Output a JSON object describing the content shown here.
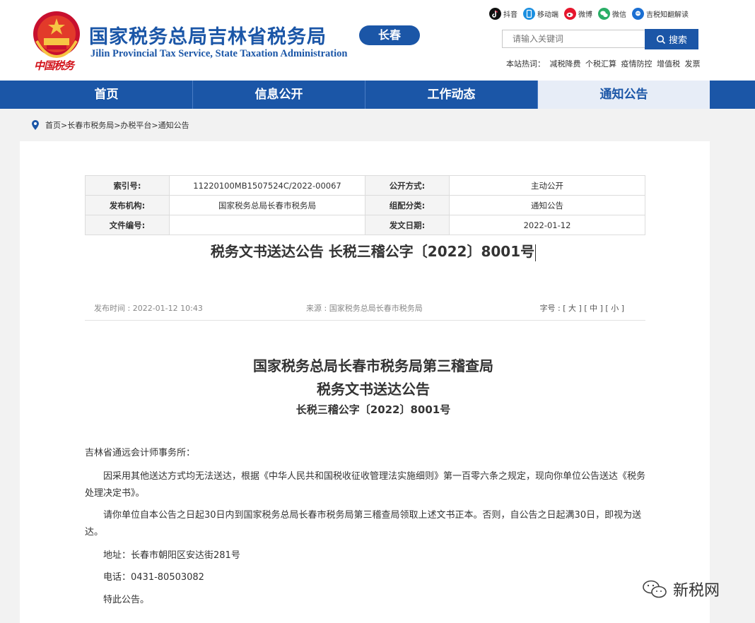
{
  "header": {
    "seal_text": "中国税务",
    "title_cn": "国家税务总局吉林省税务局",
    "title_en": "Jilin Provincial Tax Service, State Taxation Administration",
    "city": "长春",
    "social": [
      {
        "label": "抖音",
        "icon": "douyin-icon",
        "color": "#111111"
      },
      {
        "label": "移动端",
        "icon": "mobile-icon",
        "color": "#1b8fe0"
      },
      {
        "label": "微博",
        "icon": "weibo-icon",
        "color": "#e6162d"
      },
      {
        "label": "微信",
        "icon": "wechat-icon",
        "color": "#2aae67"
      },
      {
        "label": "吉税知翻解读",
        "icon": "bot-icon",
        "color": "#1b6fd2"
      }
    ],
    "search_placeholder": "请输入关键词",
    "search_button": "搜索",
    "hot_label": "本站热词：",
    "hot_words": [
      "减税降费",
      "个税汇算",
      "疫情防控",
      "增值税",
      "发票"
    ]
  },
  "nav": {
    "items": [
      {
        "label": "首页"
      },
      {
        "label": "信息公开"
      },
      {
        "label": "工作动态"
      },
      {
        "label": "通知公告"
      }
    ],
    "active_index": 3
  },
  "breadcrumb": "首页>长春市税务局>办税平台>通知公告",
  "meta": {
    "index_label": "索引号:",
    "index_value": "11220100MB1507524C/2022-00067",
    "public_label": "公开方式:",
    "public_value": "主动公开",
    "org_label": "发布机构:",
    "org_value": "国家税务总局长春市税务局",
    "category_label": "组配分类:",
    "category_value": "通知公告",
    "docno_label": "文件编号:",
    "docno_value": "",
    "date_label": "发文日期:",
    "date_value": "2022-01-12"
  },
  "doc_title": "税务文书送达公告 长税三稽公字〔2022〕8001号",
  "info": {
    "publish_time": "发布时间 : 2022-01-12 10:43",
    "source": "来源 : 国家税务总局长春市税务局",
    "font_label": "字号 :",
    "font_large": "[ 大 ]",
    "font_medium": "[ 中 ]",
    "font_small": "[ 小 ]"
  },
  "article": {
    "heading1": "国家税务总局长春市税务局第三稽查局",
    "heading2": "税务文书送达公告",
    "heading3": "长税三稽公字〔2022〕8001号",
    "addressee": "吉林省通远会计师事务所：",
    "p1": "因采用其他送达方式均无法送达，根据《中华人民共和国税收征收管理法实施细则》第一百零六条之规定，现向你单位公告送达《税务处理决定书》。",
    "p2": "请你单位自本公告之日起30日内到国家税务总局长春市税务局第三稽查局领取上述文书正本。否则，自公告之日起满30日，即视为送达。",
    "address": "地址：长春市朝阳区安达街281号",
    "phone": "电话：0431-80503082",
    "closing": "特此公告。"
  },
  "watermark": "新税网",
  "colors": {
    "brand": "#1b56a7",
    "nav_active_bg": "#e7edf7",
    "seal_red": "#d2121a"
  }
}
